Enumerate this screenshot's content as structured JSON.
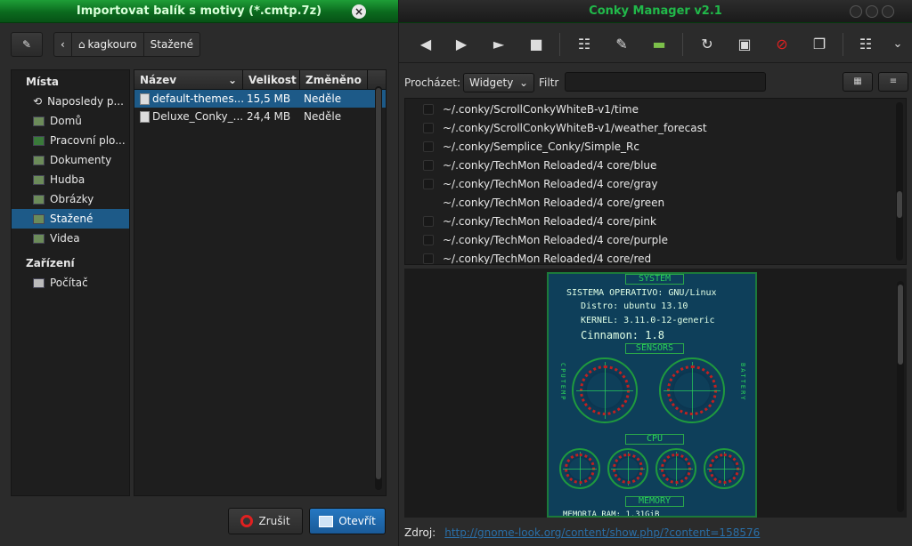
{
  "left_window": {
    "title": "Importovat balík s motivy (*.cmtp.7z)",
    "path": {
      "back": "‹",
      "segments": [
        "kagkouro",
        "Stažené"
      ]
    },
    "places_header": "Místa",
    "places": [
      {
        "label": "Naposledy p...",
        "icon": "recent-icon"
      },
      {
        "label": "Domů",
        "icon": "home-folder-icon"
      },
      {
        "label": "Pracovní plo...",
        "icon": "desktop-icon"
      },
      {
        "label": "Dokumenty",
        "icon": "folder-icon"
      },
      {
        "label": "Hudba",
        "icon": "folder-icon"
      },
      {
        "label": "Obrázky",
        "icon": "folder-icon"
      },
      {
        "label": "Stažené",
        "icon": "folder-icon",
        "selected": true
      },
      {
        "label": "Videa",
        "icon": "folder-icon"
      }
    ],
    "devices_header": "Zařízení",
    "devices": [
      {
        "label": "Počítač",
        "icon": "computer-icon"
      }
    ],
    "columns": {
      "name": "Název",
      "size": "Velikost",
      "modified": "Změněno"
    },
    "files": [
      {
        "name": "default-themes...",
        "size": "15,5 MB",
        "modified": "Neděle",
        "selected": true
      },
      {
        "name": "Deluxe_Conky_...",
        "size": "24,4 MB",
        "modified": "Neděle"
      }
    ],
    "cancel_label": "Zrušit",
    "open_label": "Otevřít"
  },
  "right_window": {
    "title": "Conky Manager v2.1",
    "browse_label": "Procházet:",
    "browse_value": "Widgety",
    "filter_label": "Filtr",
    "filter_value": "",
    "widgets": [
      {
        "path": "~/.conky/ScrollConkyWhiteB-v1/time",
        "checkbox": true
      },
      {
        "path": "~/.conky/ScrollConkyWhiteB-v1/weather_forecast",
        "checkbox": true
      },
      {
        "path": "~/.conky/Semplice_Conky/Simple_Rc",
        "checkbox": true
      },
      {
        "path": "~/.conky/TechMon Reloaded/4 core/blue",
        "checkbox": true
      },
      {
        "path": "~/.conky/TechMon Reloaded/4 core/gray",
        "checkbox": true
      },
      {
        "path": "~/.conky/TechMon Reloaded/4 core/green",
        "checkbox": false
      },
      {
        "path": "~/.conky/TechMon Reloaded/4 core/pink",
        "checkbox": true
      },
      {
        "path": "~/.conky/TechMon Reloaded/4 core/purple",
        "checkbox": true
      },
      {
        "path": "~/.conky/TechMon Reloaded/4 core/red",
        "checkbox": true
      }
    ],
    "preview": {
      "system_label": "SYSTEM",
      "line1": "SISTEMA OPERATIVO: GNU/Linux",
      "line2": "Distro: ubuntu 13.10",
      "line3": "KERNEL: 3.11.0-12-generic",
      "line4": "Cinnamon: 1.8",
      "sensors_label": "SENSORS",
      "cpu_label": "CPU",
      "memory_label": "MEMORY",
      "left_side": "CPUTEMP",
      "right_side": "BATTERY",
      "memory_line": "MEMORIA RAM: 1.31GiB"
    },
    "source_label": "Zdroj:",
    "source_link": "http://gnome-look.org/content/show.php/?content=158576"
  }
}
